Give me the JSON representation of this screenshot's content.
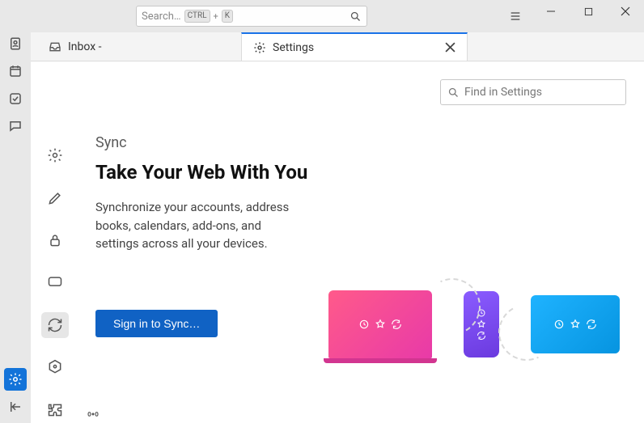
{
  "titlebar": {
    "search_placeholder": "Search…",
    "kbd1": "CTRL",
    "kbd_plus": "+",
    "kbd2": "K"
  },
  "tabs": {
    "inbox_label": "Inbox -",
    "settings_label": "Settings"
  },
  "settings": {
    "find_placeholder": "Find in Settings"
  },
  "sync": {
    "section_label": "Sync",
    "heading": "Take Your Web With You",
    "description": "Synchronize your accounts, address books, calendars, add-ons, and settings across all your devices.",
    "signin_label": "Sign in to Sync…"
  }
}
